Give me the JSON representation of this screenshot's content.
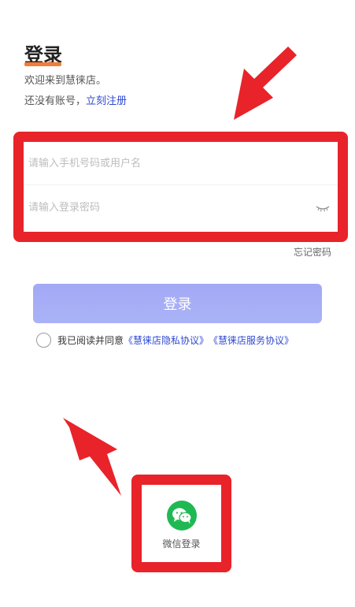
{
  "header": {
    "title": "登录",
    "welcome": "欢迎来到慧徕店。",
    "no_account": "还没有账号，",
    "register_link": "立刻注册"
  },
  "form": {
    "username_placeholder": "请输入手机号码或用户名",
    "password_placeholder": "请输入登录密码",
    "forgot_password": "忘记密码",
    "login_button": "登录"
  },
  "agreement": {
    "prefix": "我已阅读并同意",
    "privacy_link": "《慧徕店隐私协议》",
    "service_link": "《慧徕店服务协议》"
  },
  "social": {
    "wechat_label": "微信登录"
  },
  "colors": {
    "accent_underline": "#f07d38",
    "link": "#2f49d1",
    "button": "#a4a8f5",
    "annotation_red": "#e8232a",
    "wechat_green": "#1fb954"
  }
}
